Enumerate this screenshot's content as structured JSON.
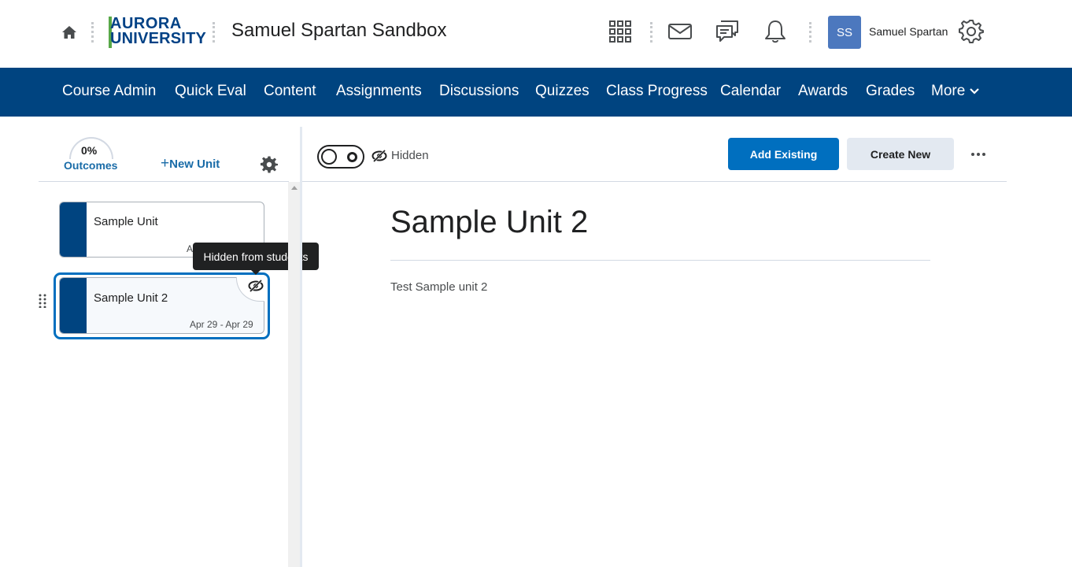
{
  "header": {
    "logo": {
      "line1": "AURORA",
      "line2": "UNIVERSITY"
    },
    "course_title": "Samuel Spartan Sandbox",
    "user_initials": "SS",
    "user_name": "Samuel Spartan",
    "icons": [
      "home-icon",
      "waffle-icon",
      "mail-icon",
      "chat-icon",
      "bell-icon",
      "settings-icon"
    ]
  },
  "nav": {
    "items": [
      "Course Admin",
      "Quick Eval",
      "Content",
      "Assignments",
      "Discussions",
      "Quizzes",
      "Class Progress",
      "Calendar",
      "Awards",
      "Grades",
      "More"
    ]
  },
  "sidebar": {
    "progress_percent": "0%",
    "outcomes_label": "Outcomes",
    "new_unit_label": "New Unit",
    "units": [
      {
        "title": "Sample Unit",
        "dates": "A"
      },
      {
        "title": "Sample Unit 2",
        "dates": "Apr 29 - Apr 29"
      }
    ],
    "tooltip": "Hidden from students"
  },
  "main": {
    "visibility_label": "Hidden",
    "add_existing_label": "Add Existing",
    "create_new_label": "Create New",
    "unit_title": "Sample Unit 2",
    "unit_description": "Test Sample unit 2"
  },
  "colors": {
    "nav_bg": "#004480",
    "primary": "#006fbf",
    "accent_green": "#58a848",
    "avatar": "#4c78be"
  }
}
